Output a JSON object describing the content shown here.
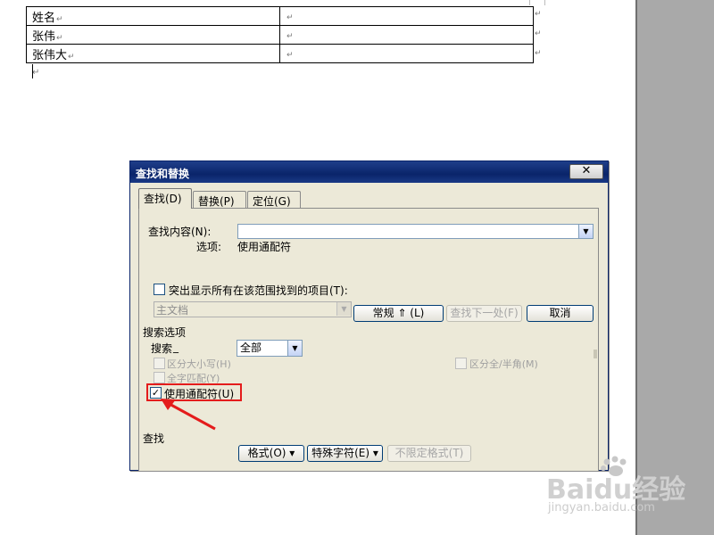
{
  "document": {
    "rows": [
      {
        "cell1": "姓名",
        "cell2": ""
      },
      {
        "cell1": "张伟",
        "cell2": ""
      },
      {
        "cell1": "张伟大",
        "cell2": ""
      }
    ],
    "mark": "↵"
  },
  "dialog": {
    "title": "查找和替换",
    "close_label": "✕",
    "tabs": [
      {
        "label": "查找(D)"
      },
      {
        "label": "替换(P)"
      },
      {
        "label": "定位(G)"
      }
    ],
    "find_label": "查找内容(N):",
    "find_value": "",
    "options_label": "选项:",
    "options_value": "使用通配符",
    "highlight_label": "突出显示所有在该范围找到的项目(T):",
    "scope_value": "主文档",
    "buttons": {
      "normal": "常规 ⇑ (L)",
      "find_next": "查找下一处(F)",
      "cancel": "取消"
    },
    "search_options_title": "搜索选项",
    "search_label": "搜索",
    "search_value": "全部",
    "match_case": "区分大小写(H)",
    "whole_word": "全字匹配(Y)",
    "wildcards": "使用通配符(U)",
    "full_half": "区分全/半角(M)",
    "find_section": "查找",
    "format_btn": "格式(O) ▾",
    "special_btn": "特殊字符(E) ▾",
    "no_format_btn": "不限定格式(T)"
  },
  "watermark": {
    "brand": "Baidu经验",
    "url": "jingyan.baidu.com"
  }
}
